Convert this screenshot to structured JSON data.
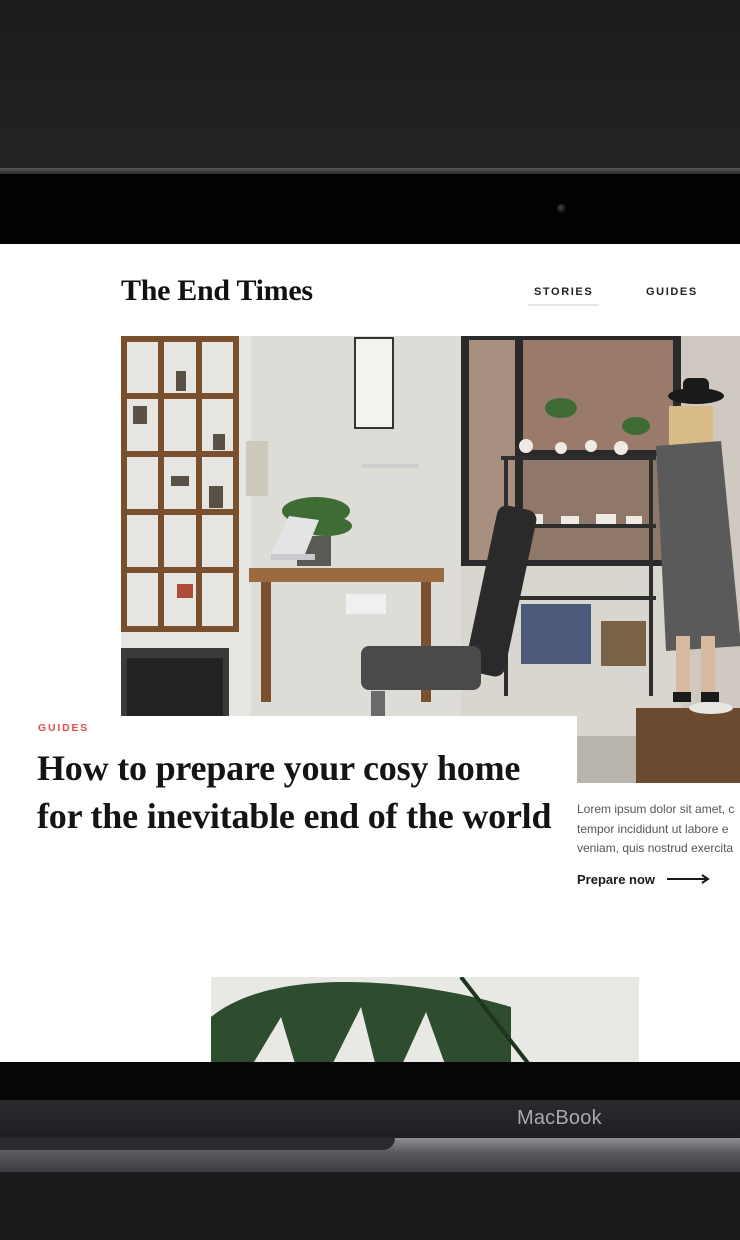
{
  "device": {
    "brand_label": "MacBook"
  },
  "site": {
    "logo": "The End Times",
    "nav": [
      {
        "label": "STORIES",
        "active": true
      },
      {
        "label": "GUIDES",
        "active": false
      }
    ]
  },
  "article": {
    "category": "GUIDES",
    "title": "How to prepare your cosy home for the inevitable end of the world",
    "excerpt": "Lorem ipsum dolor sit amet, c\ntempor incididunt ut labore e\nveniam, quis nostrud exercita",
    "cta_label": "Prepare now"
  },
  "colors": {
    "accent": "#e64d4d",
    "text": "#141414"
  }
}
